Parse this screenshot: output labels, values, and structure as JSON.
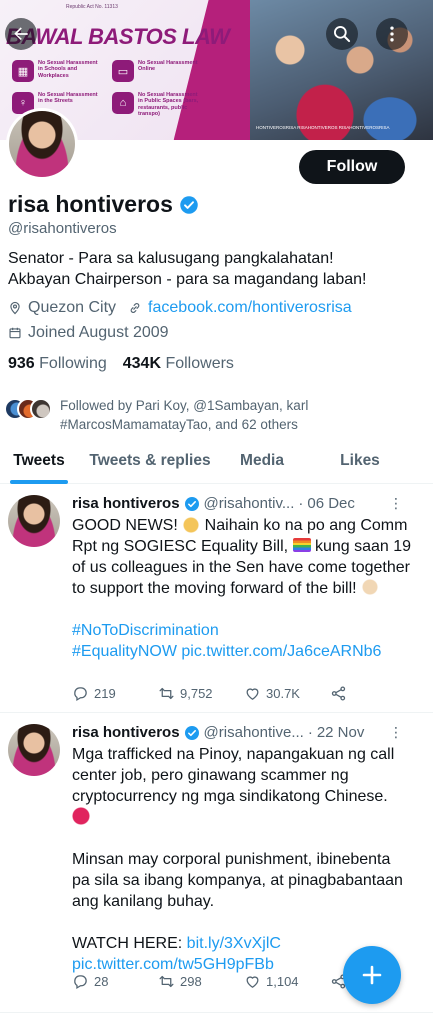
{
  "banner": {
    "republic_text": "Republic Act No. 11313",
    "title": "BAWAL BASTOS LAW",
    "items": [
      {
        "label": "No Sexual Harassment in Schools and Workplaces"
      },
      {
        "label": "No Sexual Harassment Online"
      },
      {
        "label": "No Sexual Harassment in the Streets"
      },
      {
        "label": "No Sexual Harassment in Public Spaces (bars, restaurants, public transpo)"
      }
    ],
    "footer_text": "HONTIVEROSRISA   RISAHONTIVEROS   RISAHONTIVEROSRISA"
  },
  "nav": {
    "back_icon": "arrow-left-icon",
    "search_icon": "search-icon",
    "more_icon": "more-vertical-icon"
  },
  "profile": {
    "display_name": "risa hontiveros",
    "handle": "@risahontiveros",
    "follow_label": "Follow",
    "bio_line1": "Senator - Para sa kalusugang pangkalahatan!",
    "bio_line2": "Akbayan Chairperson - para sa magandang laban!",
    "location": "Quezon City",
    "website": "facebook.com/hontiverosrisa",
    "joined": "Joined August 2009",
    "following_count": "936",
    "following_label": "Following",
    "followers_count": "434K",
    "followers_label": "Followers",
    "followed_by_text": "Followed by Pari Koy, @1Sambayan, karl #MarcosMamamatayTao, and 62 others"
  },
  "tabs": [
    {
      "label": "Tweets",
      "active": true
    },
    {
      "label": "Tweets & replies",
      "active": false
    },
    {
      "label": "Media",
      "active": false
    },
    {
      "label": "Likes",
      "active": false
    }
  ],
  "tweets": [
    {
      "name": "risa hontiveros",
      "handle": "@risahontiv...",
      "dot": "·",
      "date": "06 Dec",
      "text_1": "GOOD NEWS! ",
      "text_2": " Naihain ko na po ang Comm Rpt ng SOGIESC Equality Bill, ",
      "text_3": " kung saan 19 of us colleagues in the Sen have come together to support the moving forward of the bill! ",
      "hashtag_1": "#NoToDiscrimination",
      "hashtag_2": "#EqualityNOW",
      "link": "pic.twitter.com/Ja6ceARNb6",
      "replies": "219",
      "retweets": "9,752",
      "likes": "30.7K"
    },
    {
      "name": "risa hontiveros",
      "handle": "@risahontive...",
      "dot": "·",
      "date": "22 Nov",
      "para_1": "Mga trafficked na Pinoy, napangakuan ng call center job, pero ginawang scammer ng cryptocurrency ng mga sindikatong Chinese.",
      "para_2": "Minsan may corporal punishment, ibinebenta pa sila sa ibang kompanya, at pinagbabantaan ang kanilang buhay.",
      "watch_label": "WATCH HERE: ",
      "link_1": "bit.ly/3XvXjlC",
      "link_2": "pic.twitter.com/tw5GH9pFBb",
      "replies": "28",
      "retweets": "298",
      "likes": "1,104"
    }
  ],
  "fab": {
    "icon": "compose-plus-icon"
  },
  "colors": {
    "accent": "#1d9bf0",
    "text": "#0f1419",
    "muted": "#536471",
    "brand": "#8e1b79"
  }
}
